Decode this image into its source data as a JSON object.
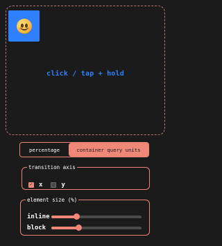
{
  "stage": {
    "hint": "click / tap + hold",
    "avatar_icon": "smiling-face-emoji"
  },
  "unit_toggle": {
    "options": [
      "percentage",
      "container query units"
    ],
    "selected": "container query units"
  },
  "transition_axis": {
    "legend": "transition axis",
    "x_label": "x",
    "x_checked": true,
    "y_label": "y",
    "y_checked": false
  },
  "element_size": {
    "legend": "element size (%)",
    "inline_label": "inline",
    "inline_value": 0.28,
    "block_label": "block",
    "block_value": 0.3
  },
  "colors": {
    "accent": "#f08878",
    "blue": "#2f80ff",
    "background": "#1b1b1b"
  }
}
